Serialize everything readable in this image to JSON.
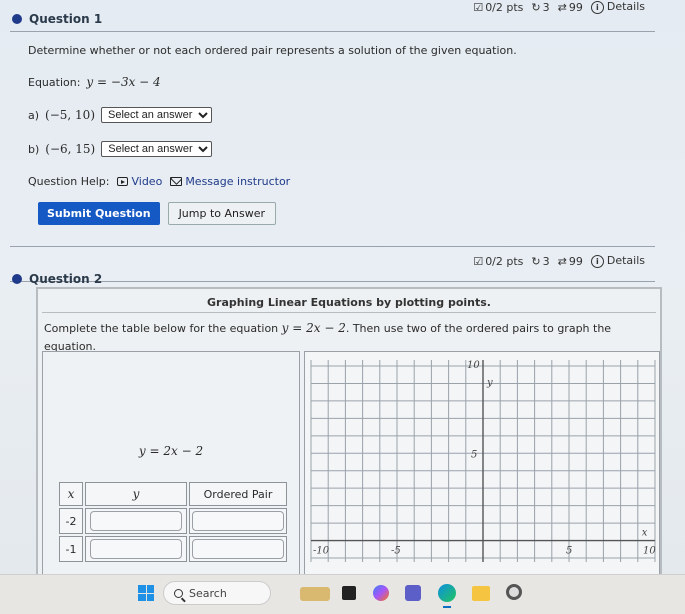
{
  "question1": {
    "title": "Question 1",
    "meta": {
      "points": "0/2 pts",
      "retries": "3",
      "attempts": "99",
      "details": "Details"
    },
    "prompt": "Determine whether or not each ordered pair represents a solution of the given equation.",
    "equation_label": "Equation:",
    "equation": "y = −3x − 4",
    "parts": [
      {
        "label": "a)",
        "pair": "(−5, 10)",
        "select": "Select an answer"
      },
      {
        "label": "b)",
        "pair": "(−6, 15)",
        "select": "Select an answer"
      }
    ],
    "help_label": "Question Help:",
    "help_video": "Video",
    "help_message": "Message instructor",
    "submit_label": "Submit Question",
    "jump_label": "Jump to Answer"
  },
  "question2": {
    "title": "Question 2",
    "meta": {
      "points": "0/2 pts",
      "retries": "3",
      "attempts": "99",
      "details": "Details"
    },
    "panel_title": "Graphing Linear Equations by plotting points.",
    "instruction_pre": "Complete the table below for the equation ",
    "instruction_eq": "y = 2x − 2",
    "instruction_post": ". Then use two of the ordered pairs to graph the equation.",
    "center_equation": "y = 2x − 2",
    "table": {
      "headers": [
        "x",
        "y",
        "Ordered Pair"
      ],
      "rows": [
        {
          "x": "-2",
          "y": "",
          "pair": ""
        },
        {
          "x": "-1",
          "y": "",
          "pair": ""
        }
      ]
    },
    "graph": {
      "x_label": "x",
      "y_label": "y",
      "x_range": [
        -10,
        10
      ],
      "y_range": [
        -1,
        10
      ],
      "x_ticks": [
        "-10",
        "-5",
        "5",
        "10"
      ],
      "y_ticks": [
        "10",
        "5"
      ]
    }
  },
  "taskbar": {
    "search_placeholder": "Search",
    "apps": [
      "widgets",
      "task-view",
      "copilot",
      "teams",
      "edge",
      "file-explorer",
      "settings"
    ]
  }
}
